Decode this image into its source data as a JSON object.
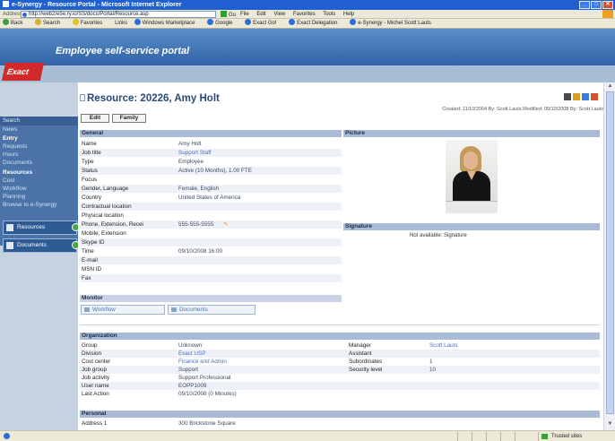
{
  "browser": {
    "title": "e-Synergy - Resource Portal - Microsoft Internet Explorer",
    "address_label": "Address",
    "address_value": "http://web2/e5e.ry.io/SS/docs/Portal/Resource.asp",
    "go_label": "Go",
    "menus": [
      "File",
      "Edit",
      "View",
      "Favorites",
      "Tools",
      "Help"
    ],
    "toolbar": [
      "Back",
      "Search",
      "Favorites",
      "Links",
      "Windows Marketplace",
      "Google",
      "Exact Go!",
      "Exact Delegation",
      "e-Synergy - Michel Scott Lauts"
    ],
    "status_zone": "Trusted sites"
  },
  "header": {
    "app_title": "Employee self-service portal",
    "logo": "Exact"
  },
  "leftnav": {
    "section_label": "Search",
    "items": [
      {
        "label": "News",
        "active": false
      },
      {
        "label": "Entry",
        "active": true
      },
      {
        "label": "Requests",
        "active": false
      },
      {
        "label": "Hours",
        "active": false
      },
      {
        "label": "Documents",
        "active": false
      },
      {
        "label": "Resources",
        "active": true
      },
      {
        "label": "Cost",
        "active": false
      },
      {
        "label": "Workflow",
        "active": false
      },
      {
        "label": "Planning",
        "active": false
      },
      {
        "label": "Browse to e-Synergy",
        "active": false
      }
    ],
    "buttons": [
      "Resources",
      "Documents"
    ]
  },
  "resource": {
    "title": "Resource: 20226, Amy Holt",
    "meta": "Created: 11/10/2004 By: Scott Lauts  Modified: 09/10/2008 By: Scott Lauts",
    "buttons": [
      "Edit",
      "Family"
    ]
  },
  "general": {
    "heading": "General",
    "rows": [
      {
        "label": "Name",
        "value": "Amy Holt",
        "link": false
      },
      {
        "label": "Job title",
        "value": "Support Staff",
        "link": true
      },
      {
        "label": "Type",
        "value": "Employee",
        "link": false
      },
      {
        "label": "Status",
        "value": "Active (10 Months), 1.00 FTE",
        "link": false
      },
      {
        "label": "Focus",
        "value": "",
        "link": false
      },
      {
        "label": "Gender, Language",
        "value": "Female, English",
        "link": false
      },
      {
        "label": "Country",
        "value": "United States of America",
        "link": false
      },
      {
        "label": "Contractual location",
        "value": "",
        "link": false
      },
      {
        "label": "Physical location",
        "value": "",
        "link": false
      },
      {
        "label": "Phone, Extension, Recei",
        "value": "555-555-5555",
        "link": false
      },
      {
        "label": "Mobile, Extension",
        "value": "",
        "link": false
      },
      {
        "label": "Skype ID",
        "value": "",
        "link": false
      },
      {
        "label": "Time",
        "value": "09/10/2008 16:00",
        "link": false
      },
      {
        "label": "E-mail",
        "value": "",
        "link": false
      },
      {
        "label": "MSN ID",
        "value": "",
        "link": false
      },
      {
        "label": "Fax",
        "value": "",
        "link": false
      }
    ]
  },
  "picture": {
    "heading": "Picture"
  },
  "signature": {
    "heading": "Signature",
    "text": "Not available: Signature"
  },
  "monitor": {
    "heading": "Monitor",
    "items": [
      "Workflow",
      "Documents"
    ]
  },
  "organization": {
    "heading": "Organization",
    "left": [
      {
        "label": "Group",
        "value": "Unknown",
        "link": false
      },
      {
        "label": "Division",
        "value": "Exact USP",
        "link": true
      },
      {
        "label": "Cost center",
        "value": "Finance and Admin",
        "link": true
      },
      {
        "label": "Job group",
        "value": "Support",
        "link": false
      },
      {
        "label": "Job activity",
        "value": "Support Professional",
        "link": false
      },
      {
        "label": "User name",
        "value": "EOPP1009",
        "link": false
      },
      {
        "label": "Last Action",
        "value": "09/10/2008 (0 Minutes)",
        "link": false
      }
    ],
    "right": [
      {
        "label": "Manager",
        "value": "Scott Lauts",
        "link": true
      },
      {
        "label": "Assistant",
        "value": "",
        "link": false
      },
      {
        "label": "Subordinates",
        "value": "1",
        "link": false
      },
      {
        "label": "Security level",
        "value": "10",
        "link": false
      }
    ]
  },
  "personal": {
    "heading": "Personal",
    "rows": [
      {
        "label": "Address 1",
        "value": "300 Brickstone Square"
      }
    ]
  }
}
